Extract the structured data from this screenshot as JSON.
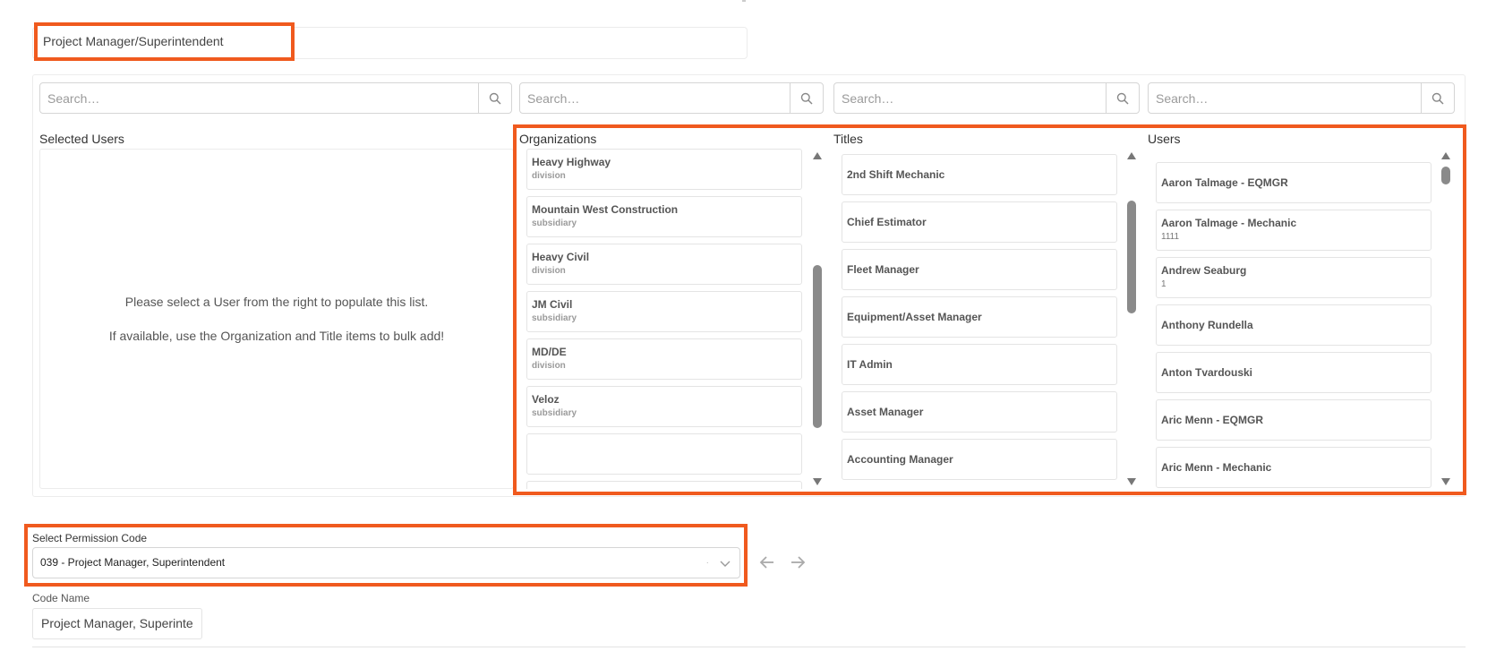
{
  "header": {
    "name_value": "Project Manager/Superintendent"
  },
  "search": {
    "selected_placeholder": "Search…",
    "organizations_placeholder": "Search…",
    "titles_placeholder": "Search…",
    "users_placeholder": "Search…"
  },
  "columns": {
    "selected_users": "Selected Users",
    "organizations": "Organizations",
    "titles": "Titles",
    "users": "Users"
  },
  "selected_hint": {
    "line1": "Please select a User from the right to populate this list.",
    "line2": "If available, use the Organization and Title items to bulk add!"
  },
  "organizations": [
    {
      "name": "Heavy Highway",
      "type": "division"
    },
    {
      "name": "Mountain West Construction",
      "type": "subsidiary"
    },
    {
      "name": "Heavy Civil",
      "type": "division"
    },
    {
      "name": "JM Civil",
      "type": "subsidiary"
    },
    {
      "name": "MD/DE",
      "type": "division"
    },
    {
      "name": "Veloz",
      "type": "subsidiary"
    },
    {
      "name": "",
      "type": ""
    }
  ],
  "titles": [
    "2nd Shift Mechanic",
    "Chief Estimator",
    "Fleet Manager",
    "Equipment/Asset Manager",
    "IT Admin",
    "Asset Manager",
    "Accounting Manager"
  ],
  "users": [
    {
      "name": "Aaron Talmage - EQMGR",
      "sub": ""
    },
    {
      "name": "Aaron Talmage - Mechanic",
      "sub": "1111"
    },
    {
      "name": "Andrew Seaburg",
      "sub": "1"
    },
    {
      "name": "Anthony Rundella",
      "sub": ""
    },
    {
      "name": "Anton Tvardouski",
      "sub": ""
    },
    {
      "name": "Aric Menn - EQMGR",
      "sub": ""
    },
    {
      "name": "Aric Menn - Mechanic",
      "sub": ""
    }
  ],
  "permission": {
    "label": "Select Permission Code",
    "selected": "039 - Project Manager, Superintendent",
    "dot": "·"
  },
  "code_name": {
    "label": "Code Name",
    "value": "Project Manager, Superinte"
  },
  "colors": {
    "highlight": "#f05a1e",
    "border": "#e4e4e4"
  },
  "icons": [
    "search-icon",
    "chevron-down-icon",
    "arrow-left-icon",
    "arrow-right-icon",
    "scroll-up-icon",
    "scroll-down-icon"
  ]
}
